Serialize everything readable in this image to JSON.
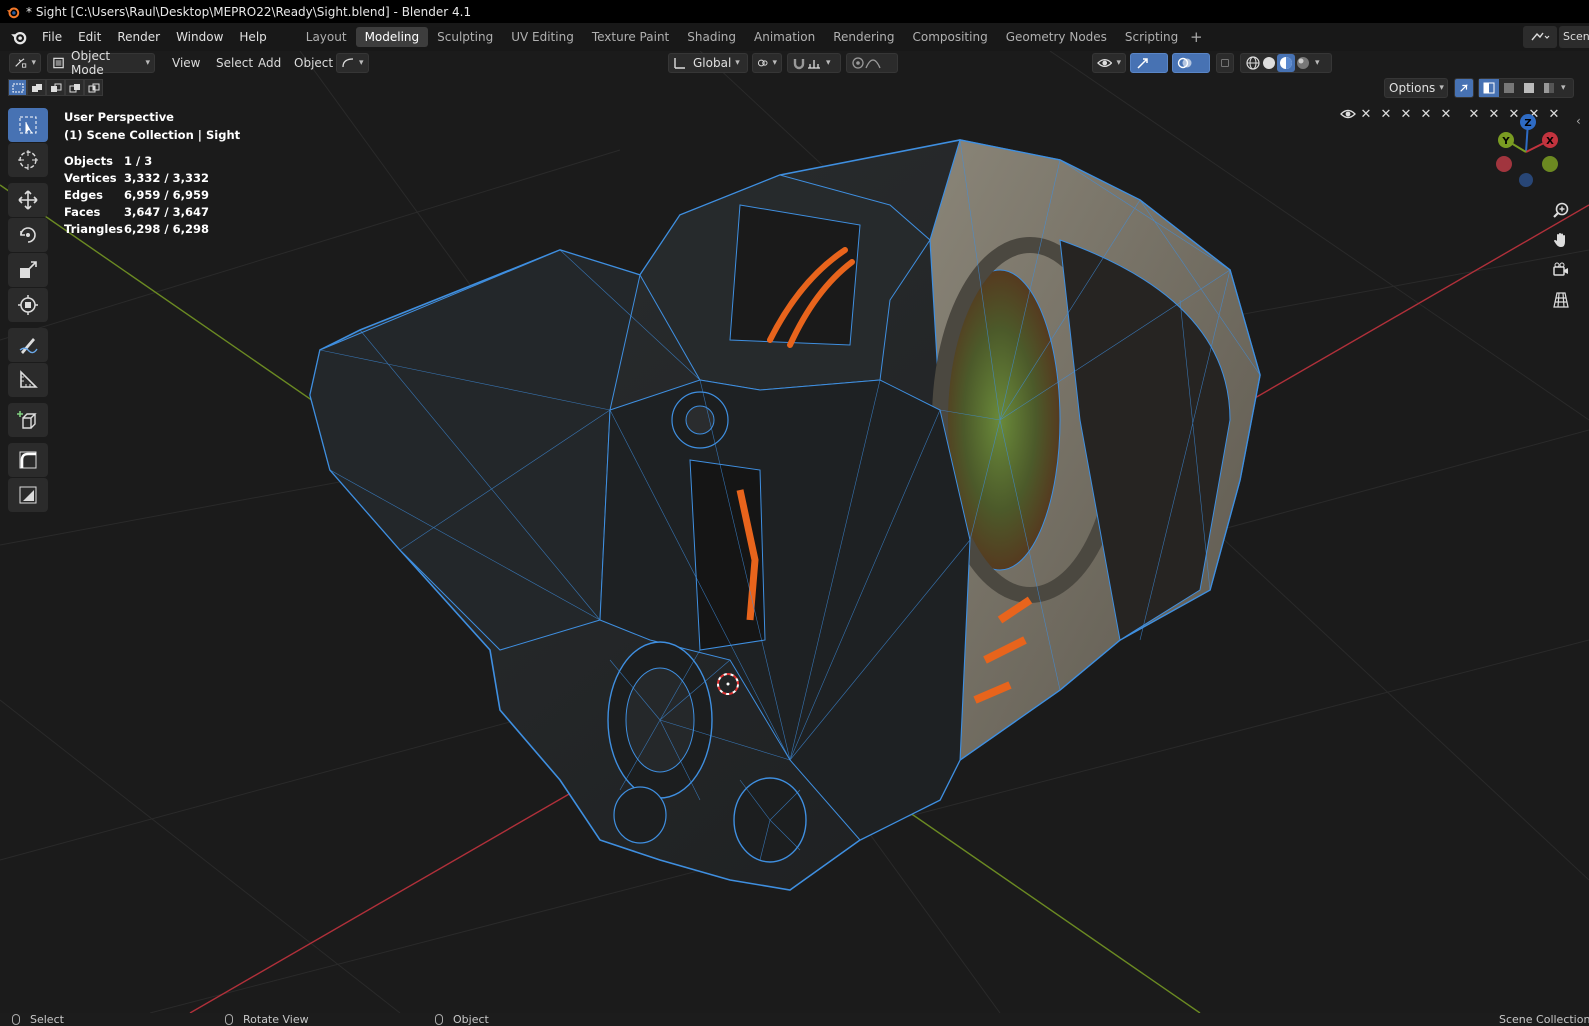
{
  "window": {
    "title": "* Sight [C:\\Users\\Raul\\Desktop\\MEPRO22\\Ready\\Sight.blend] - Blender 4.1"
  },
  "menus": [
    "File",
    "Edit",
    "Render",
    "Window",
    "Help"
  ],
  "workspaces": [
    {
      "label": "Layout",
      "active": false
    },
    {
      "label": "Modeling",
      "active": true
    },
    {
      "label": "Sculpting",
      "active": false
    },
    {
      "label": "UV Editing",
      "active": false
    },
    {
      "label": "Texture Paint",
      "active": false
    },
    {
      "label": "Shading",
      "active": false
    },
    {
      "label": "Animation",
      "active": false
    },
    {
      "label": "Rendering",
      "active": false
    },
    {
      "label": "Compositing",
      "active": false
    },
    {
      "label": "Geometry Nodes",
      "active": false
    },
    {
      "label": "Scripting",
      "active": false
    }
  ],
  "scene": {
    "name": "Scene"
  },
  "header": {
    "mode": "Object Mode",
    "view": "View",
    "select": "Select",
    "add": "Add",
    "object": "Object",
    "orientation": "Global",
    "options": "Options"
  },
  "overlay": {
    "perspective": "User Perspective",
    "collection": "(1) Scene Collection | Sight",
    "stats": [
      {
        "label": "Objects",
        "value": "1 / 3"
      },
      {
        "label": "Vertices",
        "value": "3,332 / 3,332"
      },
      {
        "label": "Edges",
        "value": "6,959 / 6,959"
      },
      {
        "label": "Faces",
        "value": "3,647 / 3,647"
      },
      {
        "label": "Triangles",
        "value": "6,298 / 6,298"
      }
    ]
  },
  "gizmo": {
    "x": "X",
    "y": "Y",
    "z": "Z"
  },
  "status": {
    "select": "Select",
    "rotate": "Rotate View",
    "object": "Object",
    "right": "Scene Collection"
  },
  "colors": {
    "accent": "#4772b3",
    "wire": "#3f8fe0",
    "orange": "#e8641c",
    "axis_x": "#c2333e",
    "axis_y": "#7a9c22",
    "axis_z": "#2e6bc4"
  }
}
